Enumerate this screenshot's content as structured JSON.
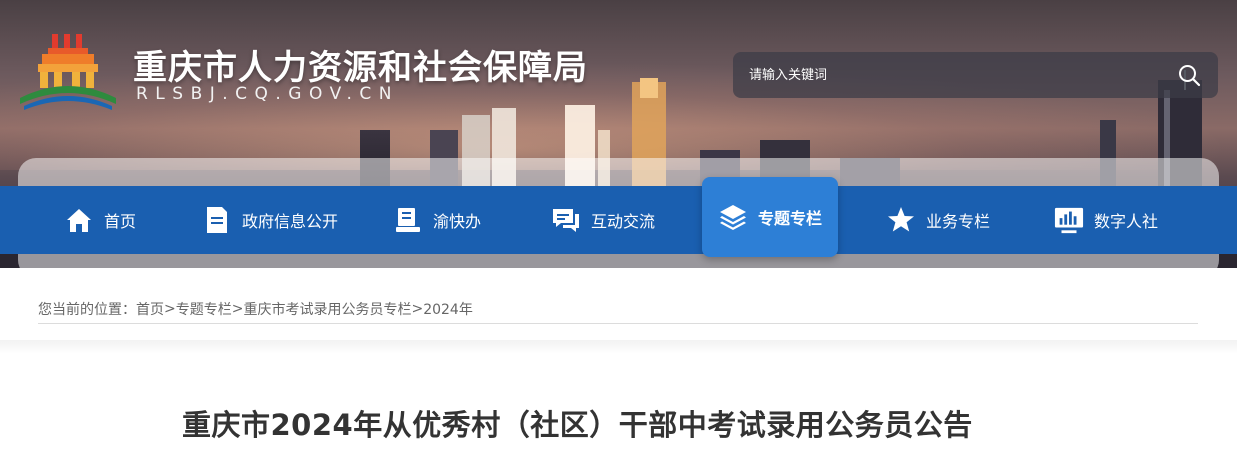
{
  "header": {
    "site_title": "重庆市人力资源和社会保障局",
    "site_domain": "RLSBJ.CQ.GOV.CN",
    "logo_icon": "temple-logo-icon"
  },
  "search": {
    "placeholder": "请输入关键词",
    "icon": "search-icon"
  },
  "nav": {
    "items": [
      {
        "label": "首页",
        "icon": "home-icon"
      },
      {
        "label": "政府信息公开",
        "icon": "document-icon"
      },
      {
        "label": "渝快办",
        "icon": "book-stack-icon"
      },
      {
        "label": "互动交流",
        "icon": "chat-icon"
      },
      {
        "label": "专题专栏",
        "icon": "layers-icon",
        "active": true
      },
      {
        "label": "业务专栏",
        "icon": "star-icon"
      },
      {
        "label": "数字人社",
        "icon": "monitor-chart-icon"
      }
    ]
  },
  "breadcrumb": {
    "prefix": "您当前的位置：",
    "items": [
      "首页",
      "专题专栏",
      "重庆市考试录用公务员专栏",
      "2024年"
    ],
    "separator": ">"
  },
  "article": {
    "title": "重庆市2024年从优秀村（社区）干部中考试录用公务员公告"
  },
  "colors": {
    "nav_bg": "#1a5fb0",
    "nav_active": "#2d7fd6",
    "text_main": "#333333",
    "text_muted": "#666666"
  }
}
